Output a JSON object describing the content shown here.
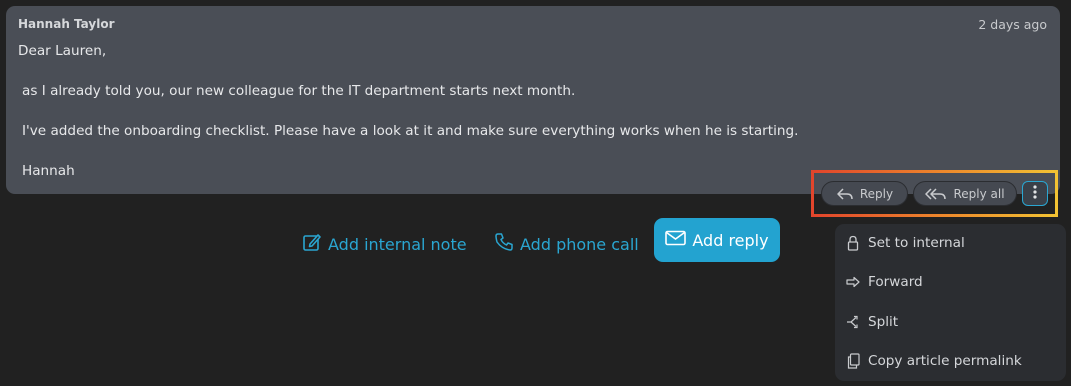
{
  "article": {
    "author": "Hannah Taylor",
    "time": "2 days ago",
    "body": [
      "Dear Lauren,",
      "as I already told you, our new colleague for the IT department starts next month.",
      "I've added the onboarding checklist. Please have a look at it and make sure everything works when he is starting.",
      "Hannah"
    ]
  },
  "reply_actions": {
    "reply": "Reply",
    "reply_all": "Reply all",
    "more_icon": "vertical-dots-icon"
  },
  "bottom_actions": {
    "internal_note": "Add internal note",
    "phone_call": "Add phone call",
    "add_reply": "Add reply"
  },
  "menu": {
    "items": [
      {
        "label": "Set to internal",
        "icon": "lock-icon"
      },
      {
        "label": "Forward",
        "icon": "forward-arrow-icon"
      },
      {
        "label": "Split",
        "icon": "split-icon"
      },
      {
        "label": "Copy article permalink",
        "icon": "copy-icon"
      }
    ]
  },
  "colors": {
    "accent": "#23a3d0",
    "background": "#212121",
    "article_bg": "#4a4e56",
    "menu_bg": "#2b2d31"
  }
}
